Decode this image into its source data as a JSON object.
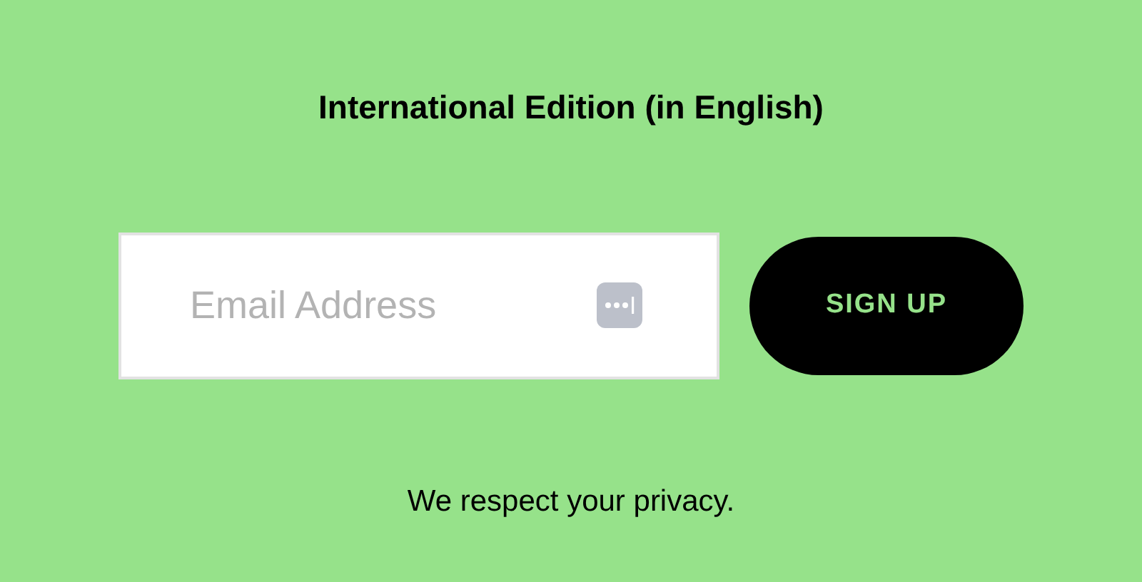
{
  "heading": "International Edition (in English)",
  "email_field": {
    "placeholder": "Email Address"
  },
  "submit_button": {
    "label": "SIGN UP"
  },
  "privacy_note": "We respect your privacy."
}
